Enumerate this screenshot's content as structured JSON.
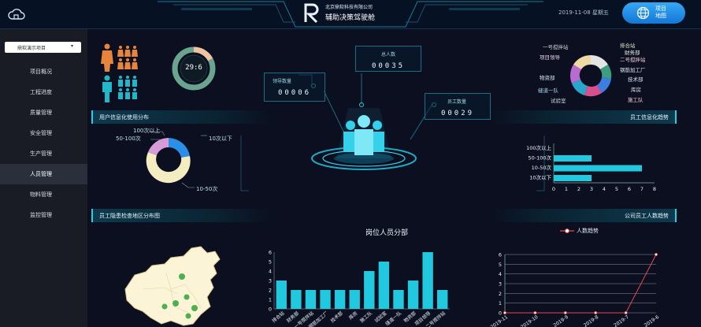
{
  "header": {
    "company": "北京鼎软科技有限公司",
    "title": "辅助决策驾驶舱",
    "datetime": "2019-11-08 星期五",
    "project_map_button": "项目\n地图"
  },
  "sidebar": {
    "project_select": "鼎软演示项目",
    "items": [
      "项目概况",
      "工程进度",
      "质量管理",
      "安全管理",
      "生产管理",
      "人员管理",
      "物料管理",
      "监控管理"
    ],
    "active_index": 5
  },
  "ratio": {
    "text": "29:6",
    "male_share": 0.83
  },
  "stats": {
    "total_label": "总人数",
    "total_value": "00035",
    "leader_label": "领导数量",
    "leader_value": "00006",
    "staff_label": "员工数量",
    "staff_value": "00029"
  },
  "department_pie": {
    "labels": [
      "一号搅拌站",
      "项目领导",
      "物资部",
      "缝道一队",
      "试验室",
      "排合站",
      "财务部",
      "二号搅拌站",
      "钢筋加工厂",
      "技术部",
      "库房",
      "施工队"
    ]
  },
  "sections": {
    "usage_dist": "用户信息化使用分布",
    "usage_trend": "员工信息化趋势",
    "health_map": "员工隐患检查地区分布图",
    "headcount_trend": "公司员工人数趋势"
  },
  "usage_donut": {
    "segments": [
      {
        "label": "100次以上",
        "value": 1,
        "color": "#2b8fe8"
      },
      {
        "label": "10次以下",
        "value": 3,
        "color": "#2b8fe8"
      },
      {
        "label": "10-50次",
        "value": 7,
        "color": "#f3edc1"
      },
      {
        "label": "50-100次",
        "value": 2,
        "color": "#d89bd8"
      }
    ]
  },
  "chart_data": [
    {
      "type": "bar",
      "orientation": "horizontal",
      "title": "",
      "categories": [
        "100次以上",
        "50-100次",
        "10-50次",
        "10次以下"
      ],
      "values": [
        0,
        3,
        7,
        3
      ],
      "xlim": [
        0,
        8
      ],
      "xticks": [
        "0",
        "1",
        "2",
        "3",
        "4",
        "5",
        "6",
        "7",
        "8"
      ],
      "color": "#22c8de"
    },
    {
      "type": "bar",
      "title": "岗位人员分部",
      "categories": [
        "排合站",
        "财务部",
        "一号搅拌站",
        "钢筋加工厂",
        "技术部",
        "库房",
        "施工队",
        "试验室",
        "缝道一队",
        "物资部",
        "项目领导",
        "二号搅拌站"
      ],
      "values": [
        3,
        2,
        2,
        2,
        2,
        2,
        4,
        5,
        2,
        3,
        6,
        2
      ],
      "ylim": [
        0,
        6
      ],
      "yticks": [
        "0",
        "1",
        "2",
        "3",
        "4",
        "5",
        "6"
      ],
      "color": "#22c8de"
    },
    {
      "type": "line",
      "title": "",
      "legend": "人数趋势",
      "categories": [
        "2019-11",
        "2019-10",
        "2019-9",
        "2019-8",
        "2019-7",
        "2019-6"
      ],
      "values": [
        0,
        0,
        0,
        0,
        0,
        6
      ],
      "ylim": [
        0,
        6
      ],
      "yticks": [
        "0",
        "1",
        "2",
        "3",
        "4",
        "5",
        "6"
      ],
      "color": "#e24b4b"
    }
  ]
}
